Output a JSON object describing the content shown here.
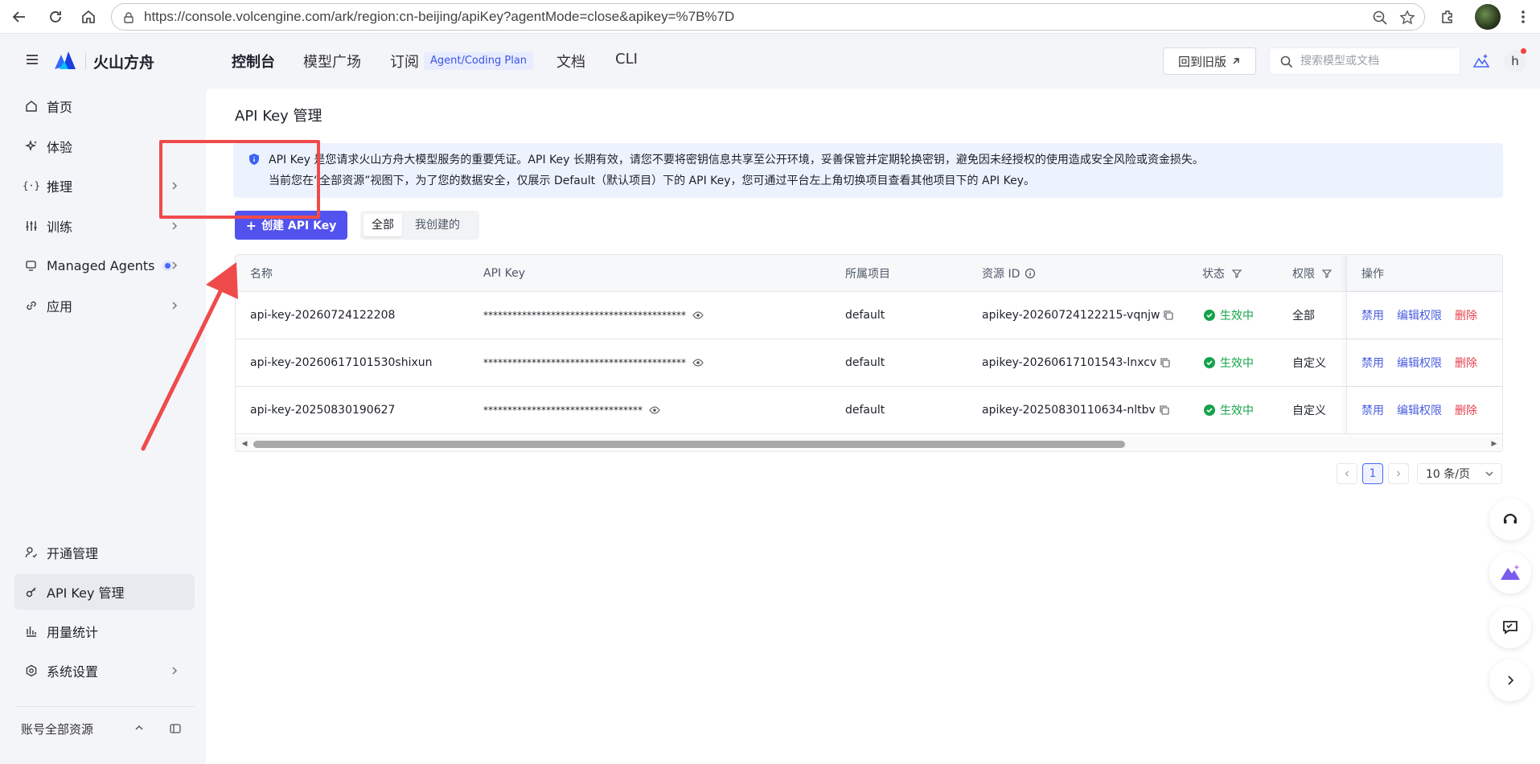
{
  "browser": {
    "url": "https://console.volcengine.com/ark/region:cn-beijing/apiKey?agentMode=close&apikey=%7B%7D"
  },
  "header": {
    "brand": "火山方舟",
    "nav": [
      "控制台",
      "模型广场",
      "订阅",
      "文档",
      "CLI"
    ],
    "nav_tag": "Agent/Coding Plan",
    "old_version_label": "回到旧版",
    "search_placeholder": "搜索模型或文档",
    "avatar_letter": "h"
  },
  "sidebar": {
    "items": [
      {
        "label": "首页",
        "icon": "home-icon"
      },
      {
        "label": "体验",
        "icon": "sparkle-icon"
      },
      {
        "label": "推理",
        "icon": "code-icon"
      },
      {
        "label": "训练",
        "icon": "sliders-icon"
      },
      {
        "label": "Managed Agents",
        "icon": "agent-icon"
      },
      {
        "label": "应用",
        "icon": "link-icon"
      },
      {
        "label": "开通管理",
        "icon": "user-check-icon"
      },
      {
        "label": "API Key 管理",
        "icon": "key-icon"
      },
      {
        "label": "用量统计",
        "icon": "bar-chart-icon"
      },
      {
        "label": "系统设置",
        "icon": "gear-icon"
      }
    ],
    "footer_label": "账号全部资源"
  },
  "page": {
    "title": "API Key 管理",
    "info_line1": "API Key 是您请求火山方舟大模型服务的重要凭证。API Key 长期有效，请您不要将密钥信息共享至公开环境，妥善保管并定期轮换密钥，避免因未经授权的使用造成安全风险或资金损失。",
    "info_line2": "当前您在“全部资源”视图下，为了您的数据安全，仅展示 Default（默认项目）下的 API Key，您可通过平台左上角切换项目查看其他项目下的 API Key。",
    "create_button": "创建 API Key",
    "filter_all": "全部",
    "filter_mine": "我创建的"
  },
  "table": {
    "columns": [
      "名称",
      "API Key",
      "所属项目",
      "资源 ID",
      "状态",
      "权限",
      "操作"
    ],
    "rows": [
      {
        "name": "api-key-20260724122208",
        "key": "******************************************",
        "project": "default",
        "resource_id": "apikey-20260724122215-vqnjw",
        "status": "生效中",
        "permission": "全部"
      },
      {
        "name": "api-key-20260617101530shixun",
        "key": "******************************************",
        "project": "default",
        "resource_id": "apikey-20260617101543-lnxcv",
        "status": "生效中",
        "permission": "自定义"
      },
      {
        "name": "api-key-20250830190627",
        "key": "*********************************",
        "project": "default",
        "resource_id": "apikey-20250830110634-nltbv",
        "status": "生效中",
        "permission": "自定义"
      }
    ],
    "actions": [
      "禁用",
      "编辑权限",
      "删除"
    ]
  },
  "pagination": {
    "current_page": "1",
    "page_size": "10 条/页"
  },
  "colors": {
    "primary": "#5252ef",
    "link": "#4a5ee0",
    "danger": "#e53e4d",
    "success": "#15a34a",
    "annotation": "#ef4b4b"
  }
}
